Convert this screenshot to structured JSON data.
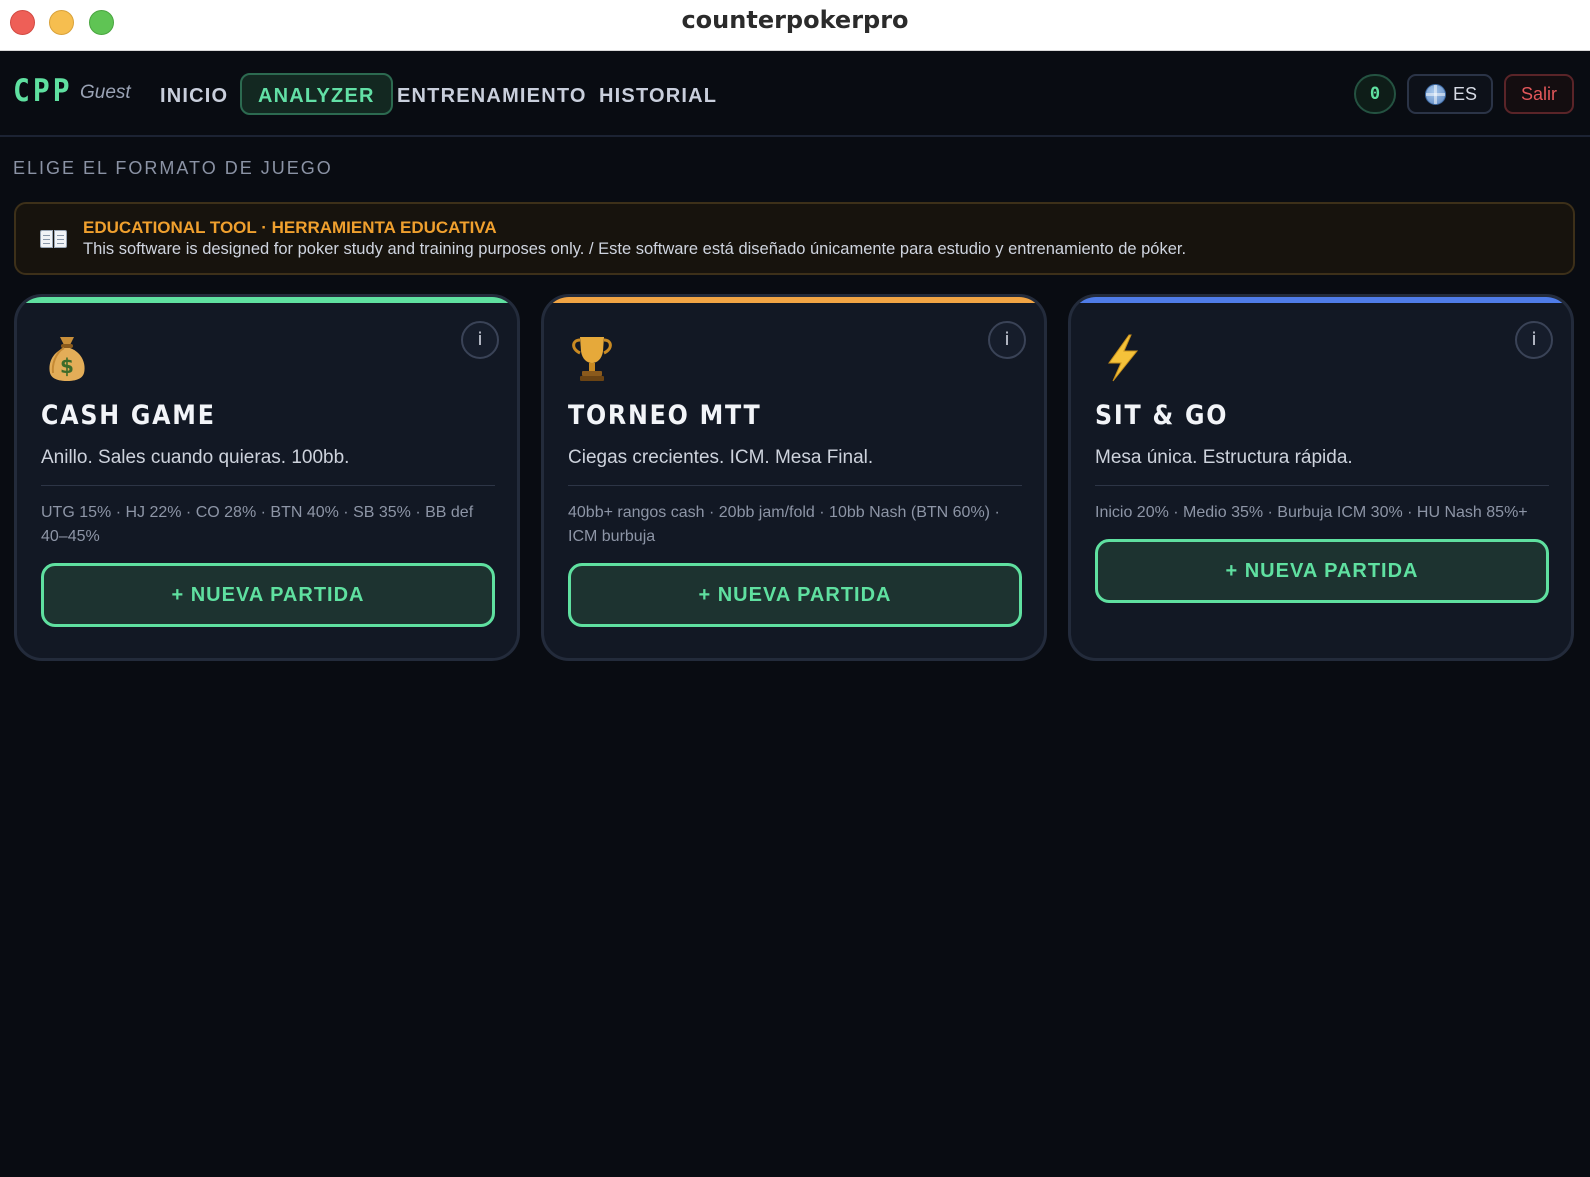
{
  "window": {
    "title": "counterpokerpro"
  },
  "nav": {
    "logo": "CPP",
    "user": "Guest",
    "items": [
      {
        "label": "INICIO",
        "active": false
      },
      {
        "label": "ANALYZER",
        "active": true
      },
      {
        "label": "ENTRENAMIENTO",
        "active": false
      },
      {
        "label": "HISTORIAL",
        "active": false
      }
    ],
    "counter": "0",
    "language": "ES",
    "logout": "Salir"
  },
  "section_title": "ELIGE EL FORMATO DE JUEGO",
  "banner": {
    "icon": "open-book-icon",
    "title": "EDUCATIONAL TOOL · HERRAMIENTA EDUCATIVA",
    "text": "This software is designed for poker study and training purposes only. / Este software está diseñado únicamente para estudio y entrenamiento de póker."
  },
  "cards": [
    {
      "icon": "money-bag-icon",
      "title": "CASH GAME",
      "subtitle": "Anillo. Sales cuando quieras. 100bb.",
      "ranges": "UTG 15% · HJ 22% · CO 28% · BTN 40% · SB 35% · BB def 40–45%",
      "button": "+ NUEVA PARTIDA",
      "info": "i",
      "accent": "#5fe0a0"
    },
    {
      "icon": "trophy-icon",
      "title": "TORNEO MTT",
      "subtitle": "Ciegas crecientes. ICM. Mesa Final.",
      "ranges": "40bb+ rangos cash · 20bb jam/fold · 10bb Nash (BTN 60%) · ICM burbuja",
      "button": "+ NUEVA PARTIDA",
      "info": "i",
      "accent": "#f0a444"
    },
    {
      "icon": "lightning-icon",
      "title": "SIT & GO",
      "subtitle": "Mesa única. Estructura rápida.",
      "ranges": "Inicio 20% · Medio 35% · Burbuja ICM 30% · HU Nash 85%+",
      "button": "+ NUEVA PARTIDA",
      "info": "i",
      "accent": "#4f7ce8"
    }
  ]
}
